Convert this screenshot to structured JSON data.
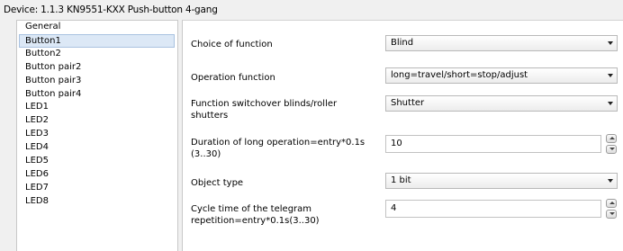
{
  "device_title": "Device: 1.1.3  KN9551-KXX Push-button 4-gang",
  "sidebar": {
    "items": [
      {
        "label": "General"
      },
      {
        "label": "Button1",
        "selected": true
      },
      {
        "label": "Button2"
      },
      {
        "label": "Button pair2"
      },
      {
        "label": "Button pair3"
      },
      {
        "label": "Button pair4"
      },
      {
        "label": "LED1"
      },
      {
        "label": "LED2"
      },
      {
        "label": "LED3"
      },
      {
        "label": "LED4"
      },
      {
        "label": "LED5"
      },
      {
        "label": "LED6"
      },
      {
        "label": "LED7"
      },
      {
        "label": "LED8"
      }
    ]
  },
  "params": {
    "choice_of_function": {
      "label": "Choice of function",
      "value": "Blind"
    },
    "operation_function": {
      "label": "Operation function",
      "value": "long=travel/short=stop/adjust"
    },
    "switchover": {
      "label": "Function switchover blinds/roller shutters",
      "value": "Shutter"
    },
    "long_duration": {
      "label": "Duration of long operation=entry*0.1s (3..30)",
      "value": "10"
    },
    "object_type": {
      "label": "Object type",
      "value": "1 bit"
    },
    "cycle_time": {
      "label": "Cycle time of the telegram repetition=entry*0.1s(3..30)",
      "value": "4"
    }
  },
  "icons": {
    "dropdown": "chevron-down-icon",
    "spin_up": "spin-up-icon",
    "spin_down": "spin-down-icon"
  },
  "colors": {
    "selection": "#dce8f6",
    "background": "#f0f0f0"
  }
}
